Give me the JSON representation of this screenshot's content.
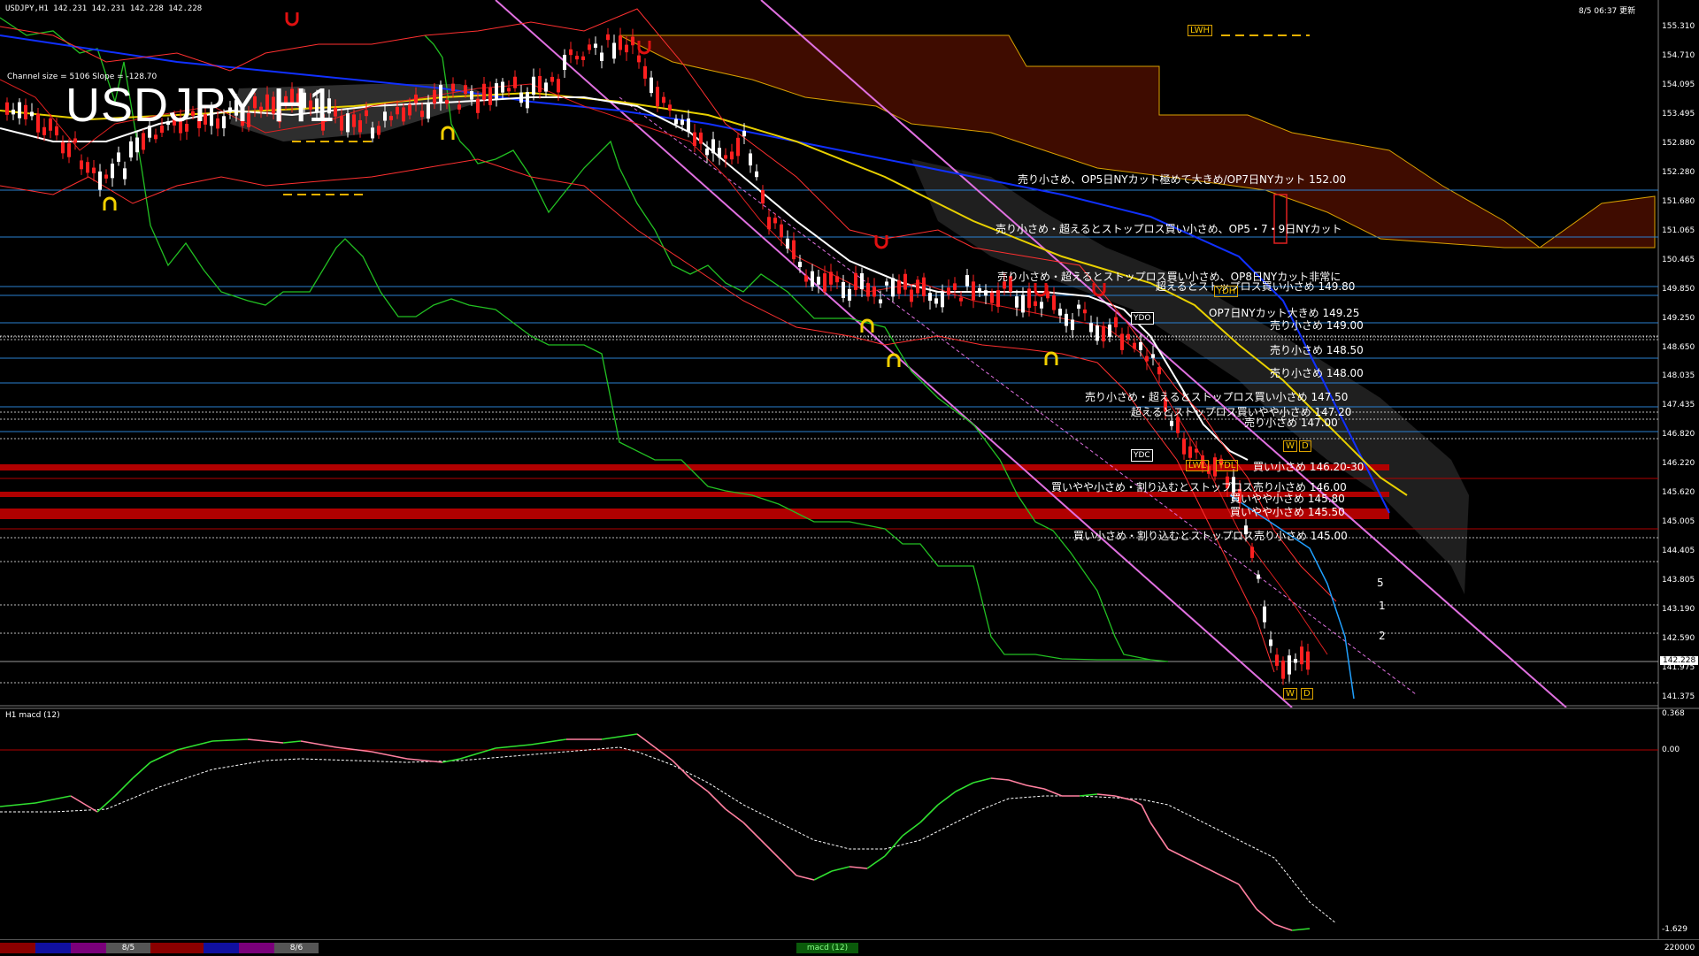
{
  "header": {
    "symbol_info": "USDJPY,H1  142.231 142.231 142.228 142.228",
    "timestamp": "8/5 06:37 更新",
    "channel_info": "Channel size = 5106 Slope = -128.70",
    "big_title": "USDJPY H1"
  },
  "price_scale": [
    "155.310",
    "154.710",
    "154.095",
    "153.495",
    "152.880",
    "152.280",
    "151.680",
    "151.065",
    "150.465",
    "149.850",
    "149.250",
    "148.650",
    "148.035",
    "147.435",
    "146.820",
    "146.220",
    "145.620",
    "145.005",
    "144.405",
    "143.805",
    "143.190",
    "142.590",
    "141.975",
    "141.375"
  ],
  "current_price": "142.228",
  "macd": {
    "label": "H1  macd (12)",
    "scale_top": "0.368",
    "scale_zero": "0.00",
    "scale_bottom": "-1.629"
  },
  "notes": [
    {
      "text": "売り小さめ、OP5日NYカット極めて大きめ/OP7日NYカット 152.00"
    },
    {
      "text": "売り小さめ・超えるとストップロス買い小さめ、OP5・7・9日NYカット"
    },
    {
      "text": "売り小さめ・超えるとストップロス買い小さめ、OP8日NYカット非常に"
    },
    {
      "text": "超えるとストップロス買い小さめ 149.80"
    },
    {
      "text": "OP7日NYカット大きめ 149.25"
    },
    {
      "text": "売り小さめ 149.00"
    },
    {
      "text": "売り小さめ 148.50"
    },
    {
      "text": "売り小さめ 148.00"
    },
    {
      "text": "売り小さめ・超えるとストップロス買い小さめ 147.50"
    },
    {
      "text": "超えるとストップロス買いやや小さめ 147.20"
    },
    {
      "text": "売り小さめ 147.00"
    },
    {
      "text": "買い小さめ 146.20-30"
    },
    {
      "text": "買いやや小さめ・割り込むとストップロス売り小さめ 146.00"
    },
    {
      "text": "買いやや小さめ 145.80"
    },
    {
      "text": "買いやや小さめ 145.50"
    },
    {
      "text": "買い小さめ・割り込むとストップロス売り小さめ 145.00"
    }
  ],
  "tags": {
    "ydo": "YDO",
    "ydc": "YDC",
    "lwh": "LWH",
    "lwl": "LWL",
    "ydl": "YDL",
    "ydh": "YDH",
    "w": "W",
    "d": "D"
  },
  "wave_labels": [
    "5",
    "1",
    "2"
  ],
  "timebar": {
    "date1": "8/5",
    "date2": "8/6",
    "macd_tab": "macd (12)",
    "right_value": "220000"
  },
  "colors": {
    "background": "#000000",
    "cloud": "#8b1a00",
    "ichimoku_chikou": "#22c022",
    "ma_white": "#ffffff",
    "ma_yellow": "#e8d000",
    "ma_blue": "#1030ff",
    "channel": "#e070e0",
    "bull_candle": "#ffffff",
    "bear_candle": "#ff2020",
    "macd_main": "#ff80a0",
    "macd_signal": "#ffffff"
  }
}
